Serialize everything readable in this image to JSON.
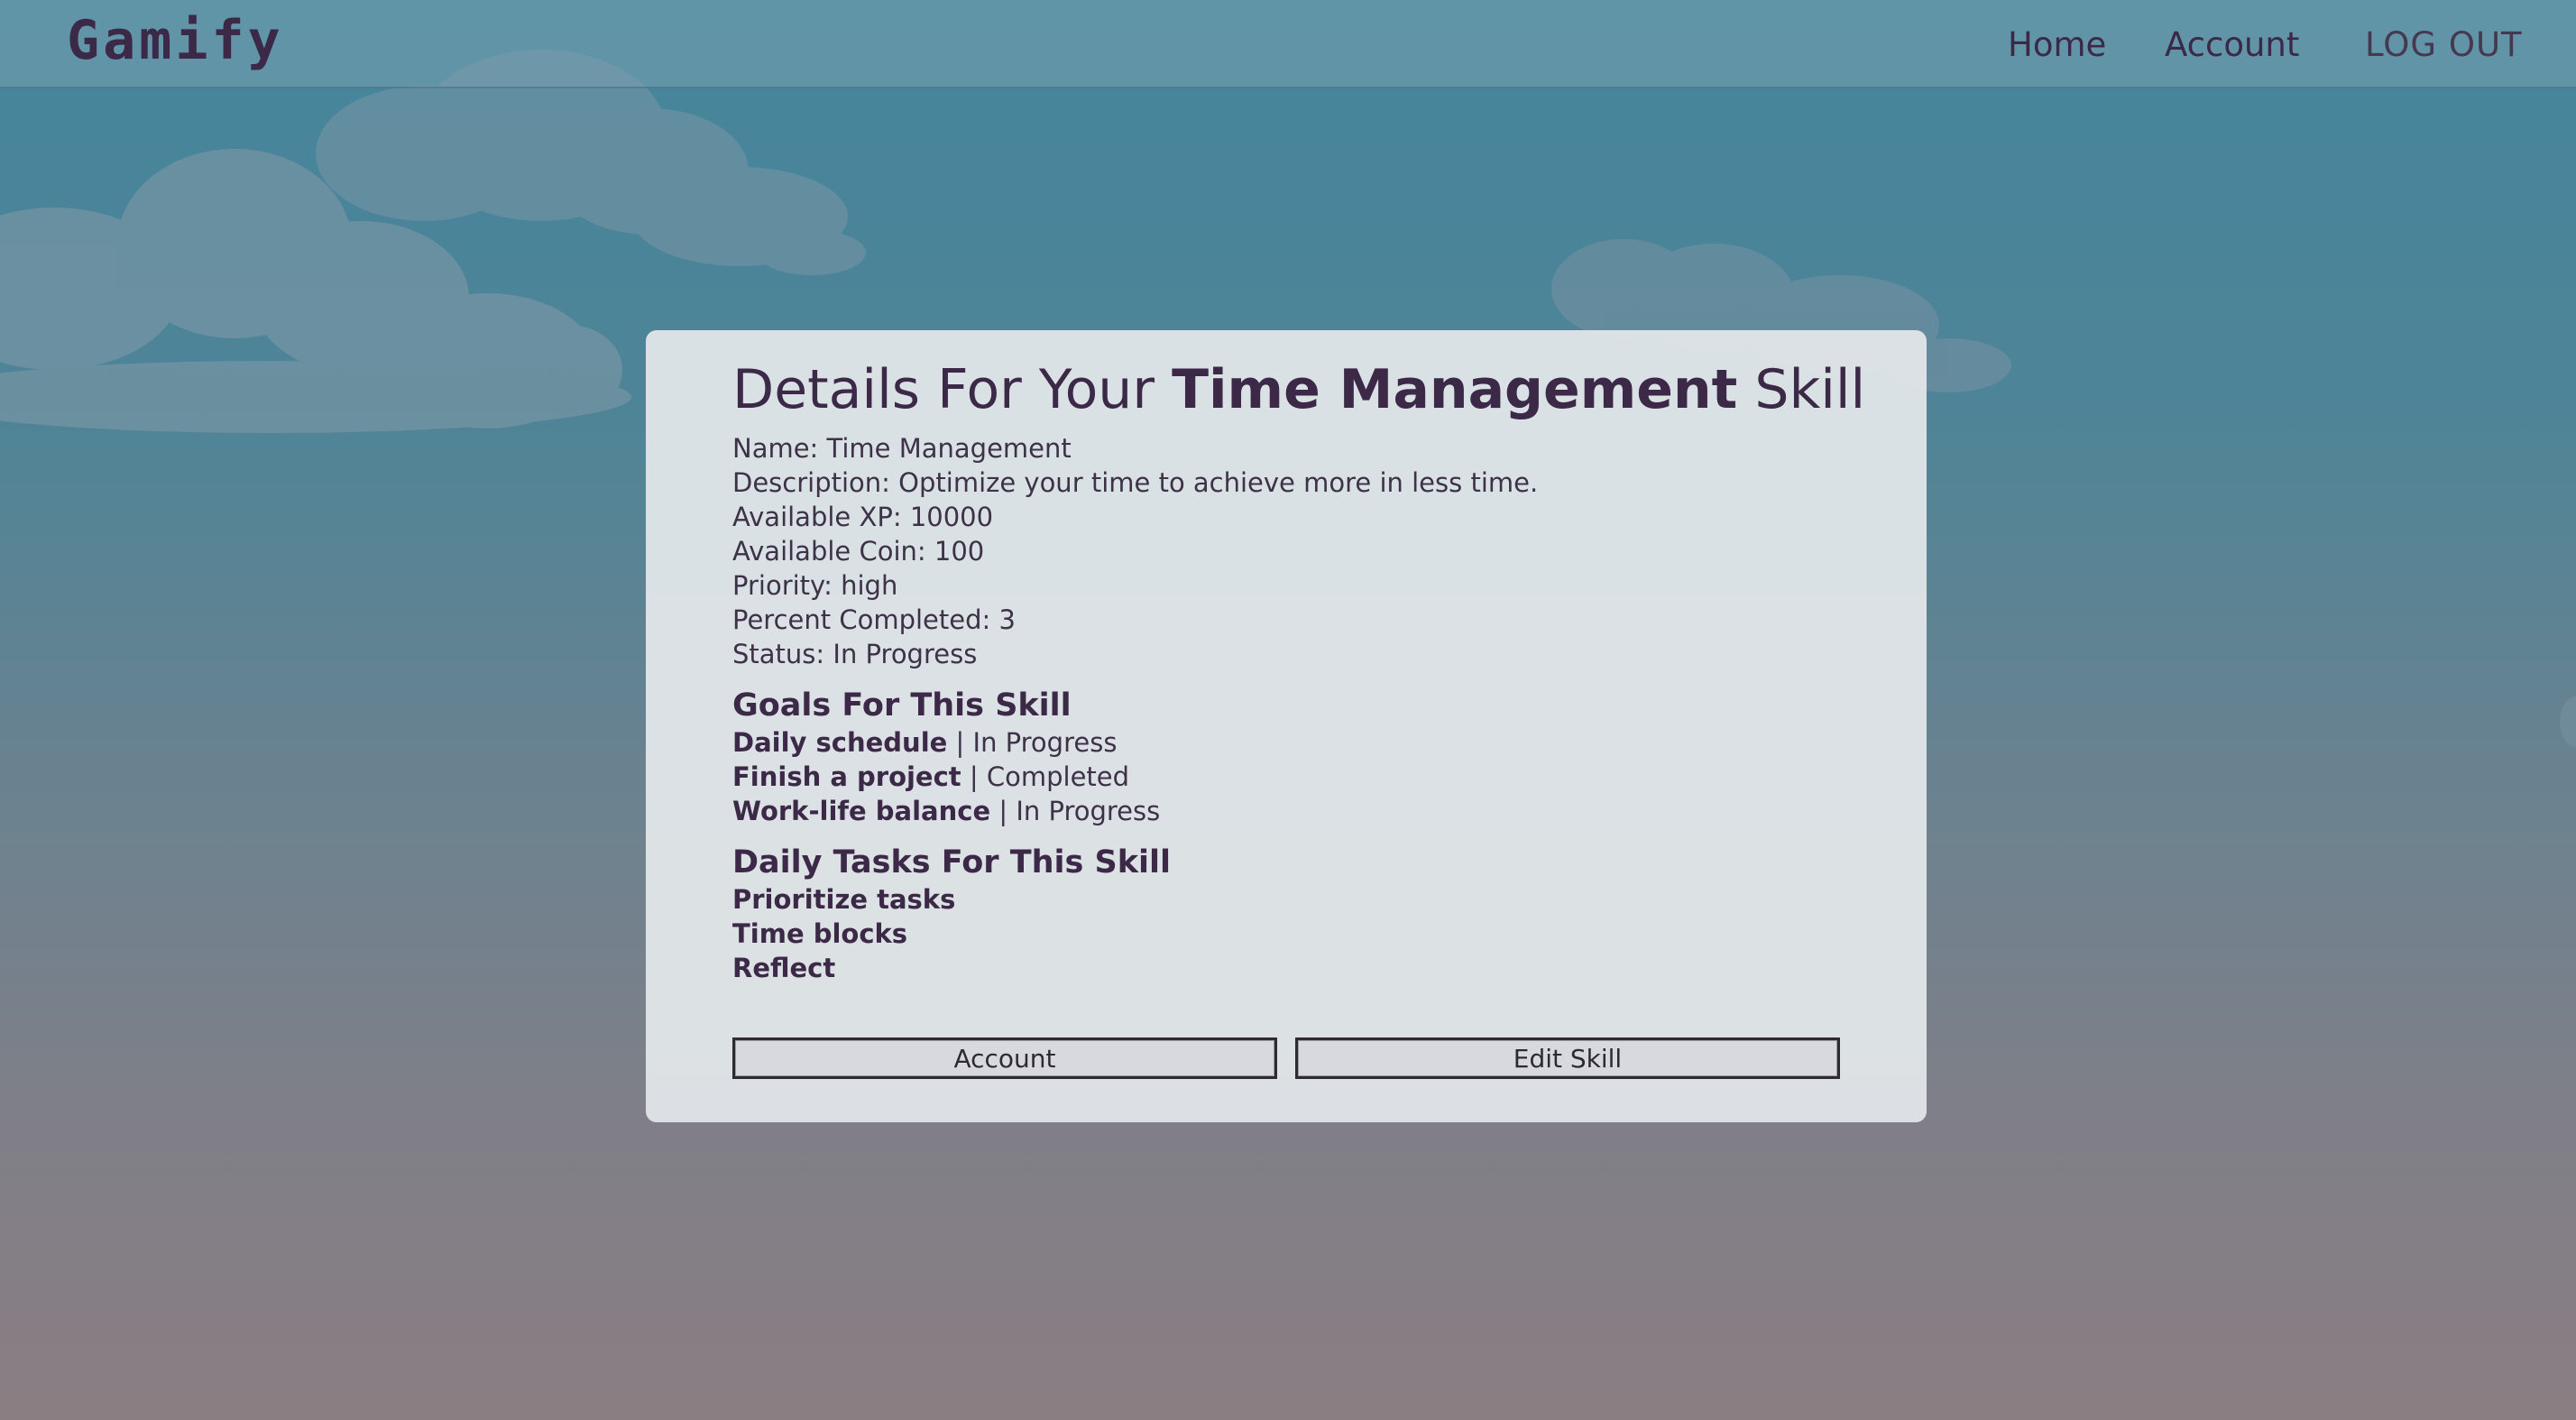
{
  "app": {
    "logo": "Gamify"
  },
  "nav": {
    "home": "Home",
    "account": "Account",
    "logout": "LOG OUT"
  },
  "card": {
    "title_prefix": "Details For Your ",
    "title_skill": "Time Management",
    "title_suffix": " Skill",
    "details": {
      "name": "Name: Time Management",
      "description": "Description: Optimize your time to achieve more in less time.",
      "xp": "Available XP: 10000",
      "coin": "Available Coin: 100",
      "priority": "Priority: high",
      "percent": "Percent Completed: 3",
      "status": "Status: In Progress"
    },
    "goals_heading": "Goals For This Skill",
    "goals": [
      {
        "name": "Daily schedule",
        "status": " | In Progress"
      },
      {
        "name": "Finish a project",
        "status": " | Completed"
      },
      {
        "name": "Work-life balance",
        "status": " | In Progress"
      }
    ],
    "tasks_heading": "Daily Tasks For This Skill",
    "tasks": [
      "Prioritize tasks",
      "Time blocks",
      "Reflect"
    ],
    "buttons": {
      "account": "Account",
      "edit": "Edit Skill"
    }
  }
}
